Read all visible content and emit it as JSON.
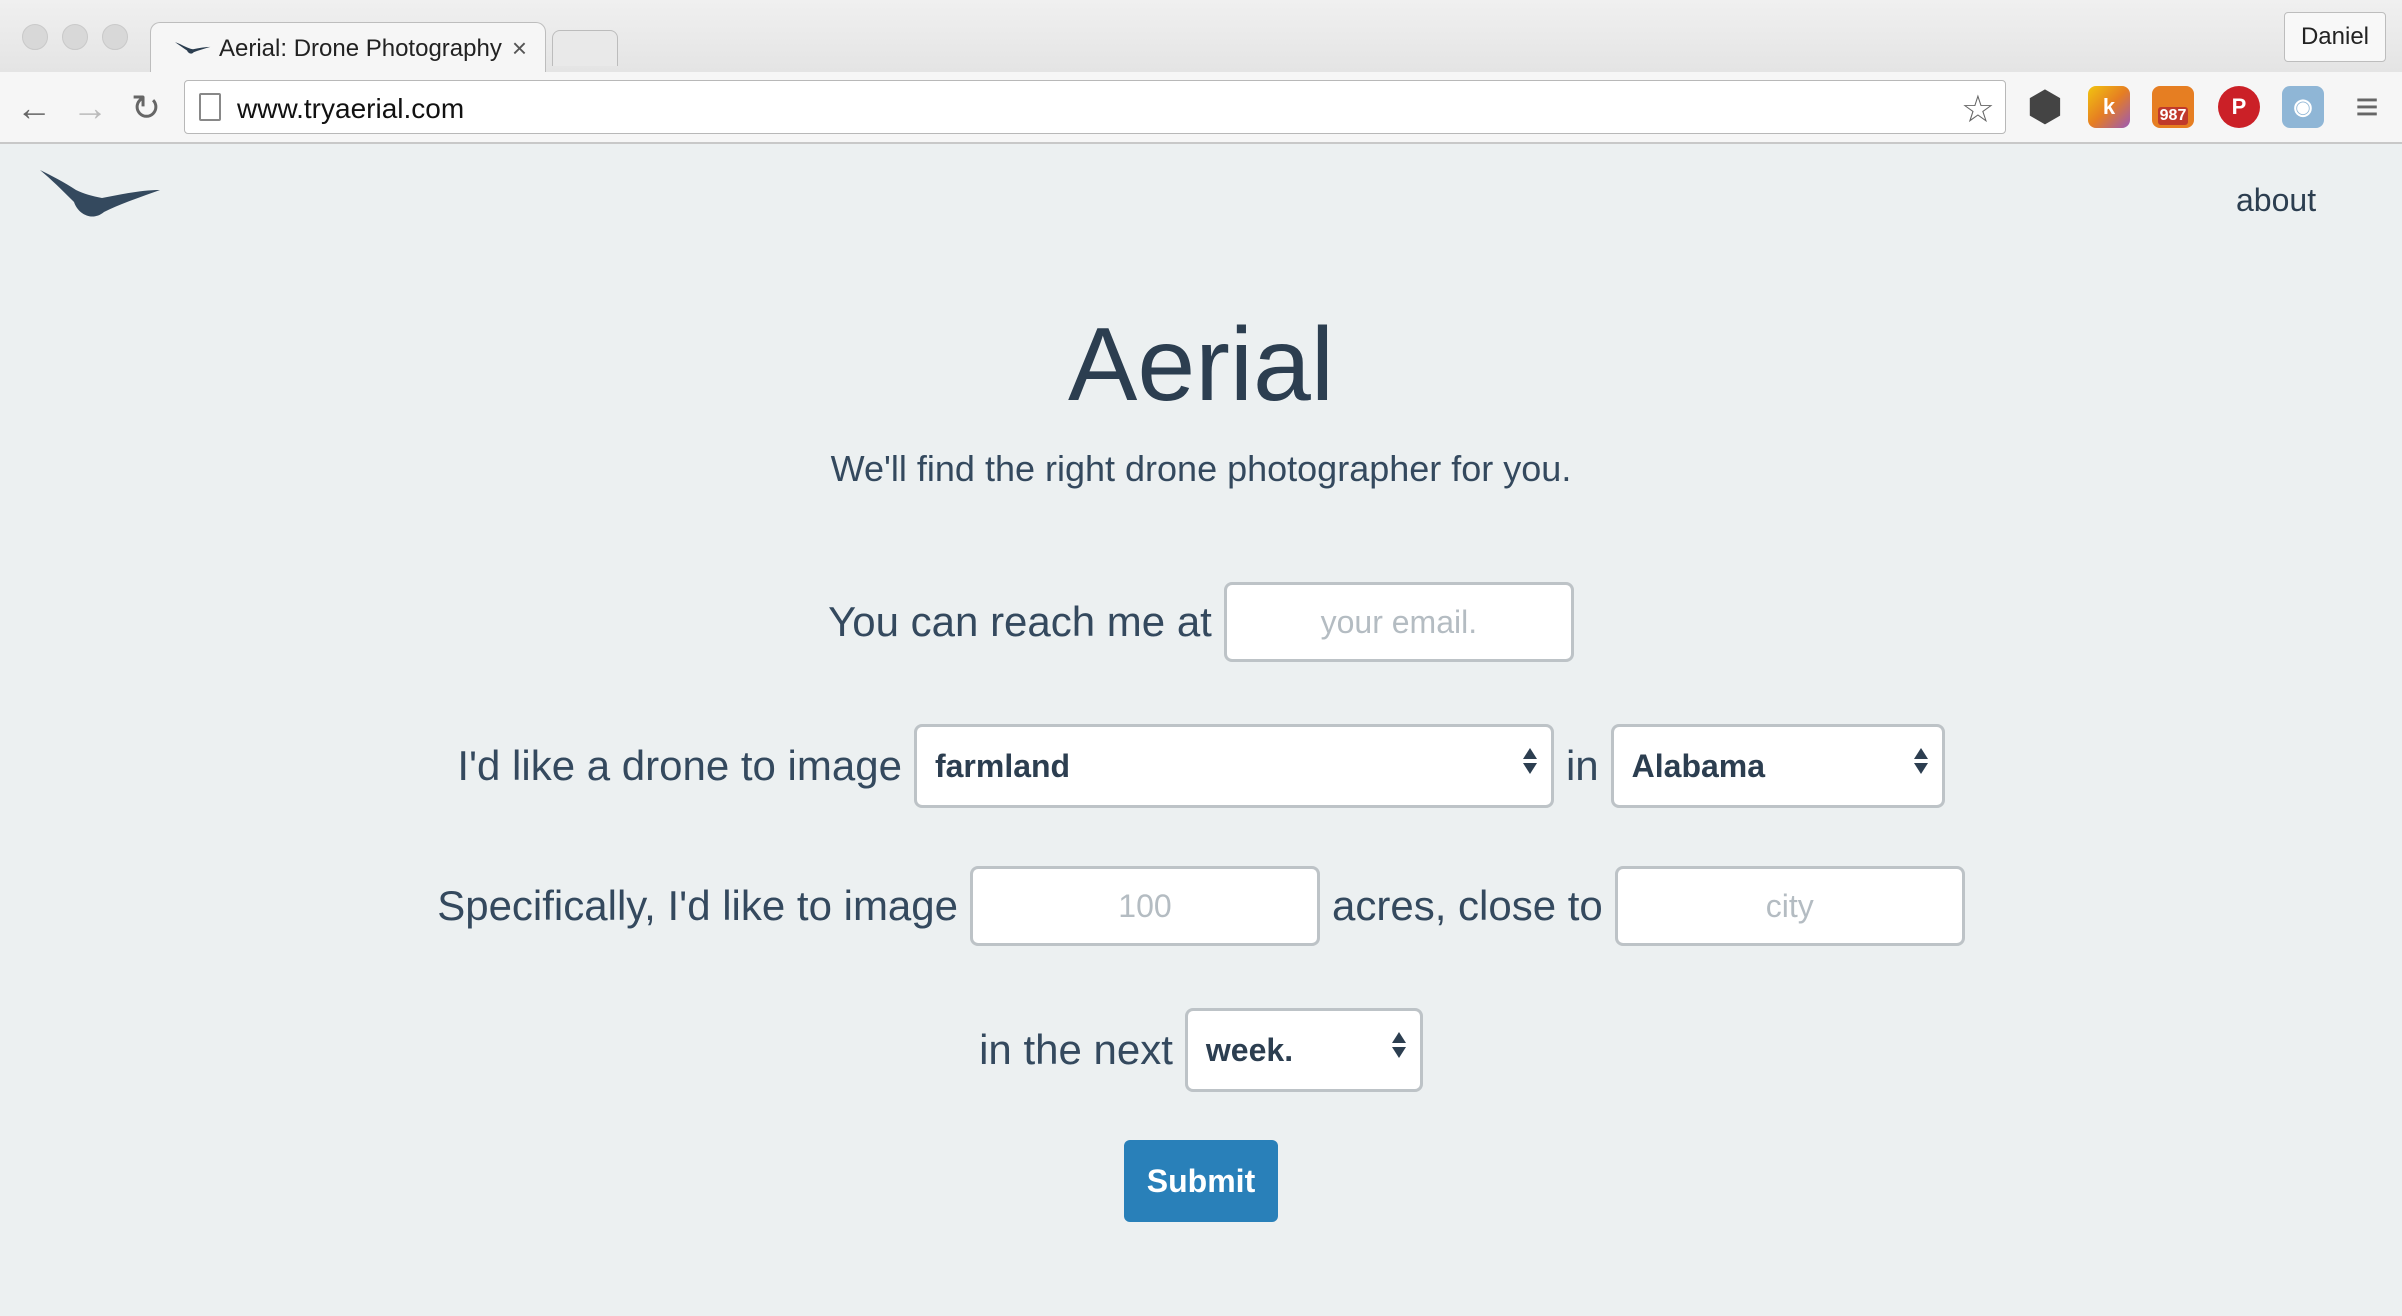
{
  "browser": {
    "tab_title": "Aerial: Drone Photography",
    "tab_close": "×",
    "profile_name": "Daniel",
    "url": "www.tryaerial.com",
    "back": "←",
    "forward": "→",
    "reload": "↻",
    "star": "☆",
    "extensions": [
      {
        "name": "hex-extension-icon",
        "color": "#444444",
        "glyph": "⬢"
      },
      {
        "name": "k-extension-icon",
        "color": "#f39c12",
        "glyph": "k"
      },
      {
        "name": "rss-extension-icon",
        "color": "#e67e22",
        "glyph": "987"
      },
      {
        "name": "pinterest-extension-icon",
        "color": "#cb2027",
        "glyph": "P"
      },
      {
        "name": "camera-extension-icon",
        "color": "#8fb6d6",
        "glyph": "◉"
      },
      {
        "name": "menu-icon",
        "color": "#666666",
        "glyph": "≡"
      }
    ]
  },
  "nav": {
    "about_label": "about"
  },
  "hero": {
    "title": "Aerial",
    "subtitle": "We'll find the right drone photographer for you."
  },
  "form": {
    "row1_label": "You can reach me at",
    "email_placeholder": "your email.",
    "row2_label": "I'd like a drone to image",
    "subject_value": "farmland",
    "in_label": "in",
    "state_value": "Alabama",
    "row3_label": "Specifically, I'd like to image",
    "acres_placeholder": "100",
    "acres_label": "acres, close to",
    "city_placeholder": "city",
    "row4_label": "in the next",
    "time_value": "week.",
    "submit_label": "Submit"
  },
  "colors": {
    "page_bg": "#ecf0f1",
    "text": "#2c3e50",
    "accent": "#2980b9"
  }
}
